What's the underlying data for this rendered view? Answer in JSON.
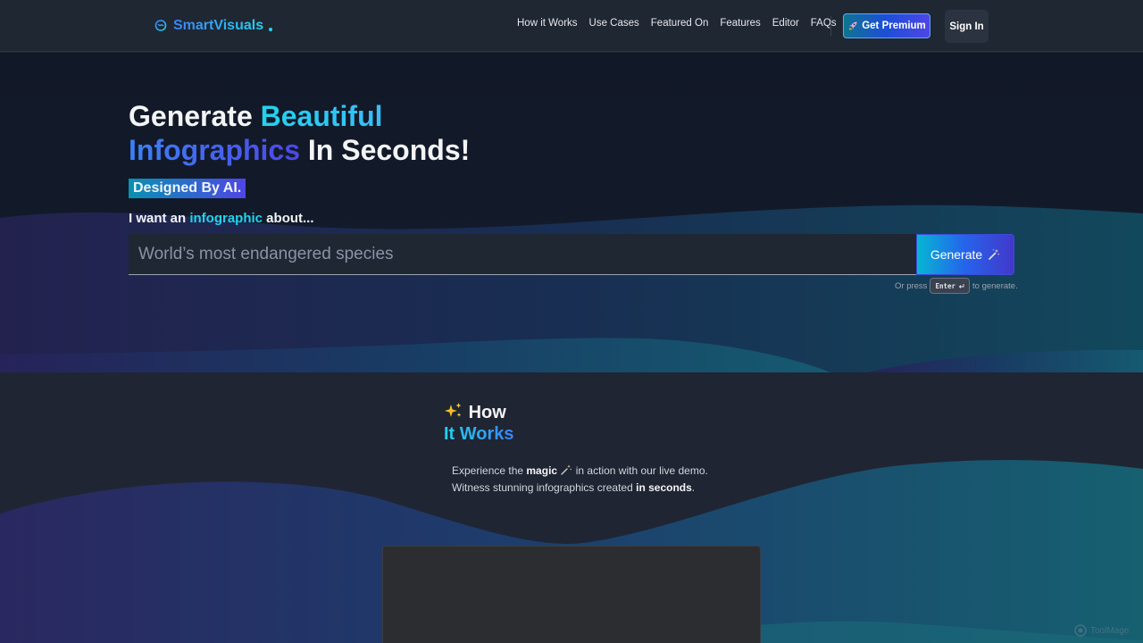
{
  "brand": {
    "name": "SmartVisuals",
    "accent": "#22d3ee",
    "logo_icon": "brain-icon"
  },
  "nav": {
    "links": [
      "How it Works",
      "Use Cases",
      "Featured On",
      "Features",
      "Editor",
      "FAQs"
    ],
    "premium_label": "Get Premium",
    "premium_icon": "rocket-icon",
    "signin_label": "Sign In"
  },
  "hero": {
    "title_part1": "Generate ",
    "title_highlight1": "Beautiful",
    "title_highlight2": "Infographics",
    "title_part2": " In Seconds!",
    "badge": "Designed By AI.",
    "prompt_prefix": "I want an ",
    "prompt_highlight": "infographic",
    "prompt_suffix": " about...",
    "input_placeholder": "World’s most endangered species",
    "generate_label": "Generate",
    "generate_icon": "magic-wand-icon",
    "hint_prefix": "Or press",
    "hint_key": "Enter",
    "hint_key_icon": "return-icon",
    "hint_suffix": "to generate."
  },
  "how": {
    "sparkle_icon": "sparkles-icon",
    "title_line1": "How",
    "title_line2": "It Works",
    "desc_1": "Experience the ",
    "desc_2": "magic",
    "desc_3": " in action with our live demo.",
    "desc_4": "Witness stunning infographics created ",
    "desc_5": "in seconds",
    "desc_6": "."
  },
  "watermark": {
    "text": "ToolMage",
    "icon": "toolmage-logo-icon"
  }
}
